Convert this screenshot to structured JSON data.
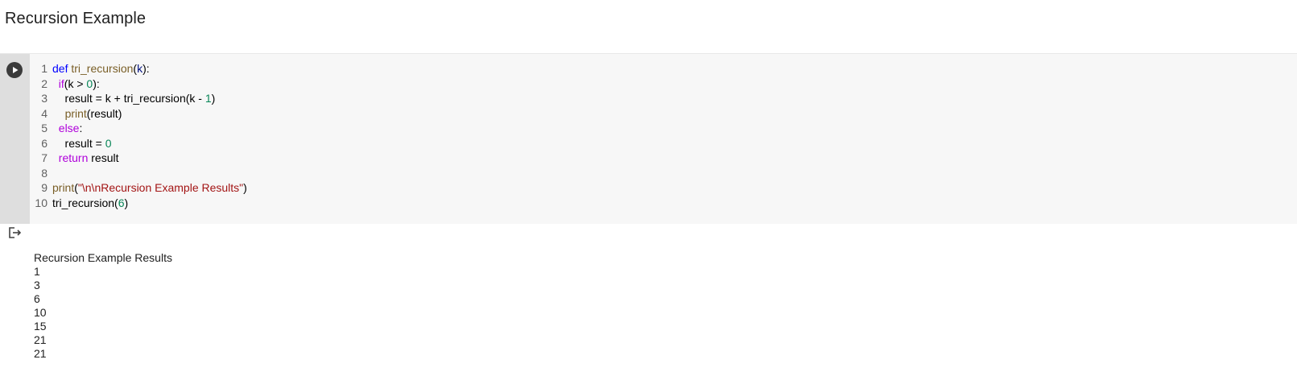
{
  "page": {
    "heading": "Recursion Example"
  },
  "cell": {
    "lines": [
      {
        "num": "1",
        "tokens": [
          {
            "t": "def",
            "c": "k"
          },
          {
            "t": " ",
            "c": "plain"
          },
          {
            "t": "tri_recursion",
            "c": "fn"
          },
          {
            "t": "(",
            "c": "plain"
          },
          {
            "t": "k",
            "c": "id"
          },
          {
            "t": "):",
            "c": "plain"
          }
        ]
      },
      {
        "num": "2",
        "tokens": [
          {
            "t": "  ",
            "c": "plain"
          },
          {
            "t": "if",
            "c": "kw"
          },
          {
            "t": "(k > ",
            "c": "plain"
          },
          {
            "t": "0",
            "c": "num"
          },
          {
            "t": "):",
            "c": "plain"
          }
        ]
      },
      {
        "num": "3",
        "tokens": [
          {
            "t": "    result = k + tri_recursion(k - ",
            "c": "plain"
          },
          {
            "t": "1",
            "c": "num"
          },
          {
            "t": ")",
            "c": "plain"
          }
        ]
      },
      {
        "num": "4",
        "tokens": [
          {
            "t": "    ",
            "c": "plain"
          },
          {
            "t": "print",
            "c": "fn"
          },
          {
            "t": "(result)",
            "c": "plain"
          }
        ]
      },
      {
        "num": "5",
        "tokens": [
          {
            "t": "  ",
            "c": "plain"
          },
          {
            "t": "else",
            "c": "kw"
          },
          {
            "t": ":",
            "c": "plain"
          }
        ]
      },
      {
        "num": "6",
        "tokens": [
          {
            "t": "    result = ",
            "c": "plain"
          },
          {
            "t": "0",
            "c": "num"
          }
        ]
      },
      {
        "num": "7",
        "tokens": [
          {
            "t": "  ",
            "c": "plain"
          },
          {
            "t": "return",
            "c": "kw"
          },
          {
            "t": " result",
            "c": "plain"
          }
        ]
      },
      {
        "num": "8",
        "tokens": []
      },
      {
        "num": "9",
        "tokens": [
          {
            "t": "print",
            "c": "fn"
          },
          {
            "t": "(",
            "c": "plain"
          },
          {
            "t": "\"\\n\\nRecursion Example Results\"",
            "c": "str"
          },
          {
            "t": ")",
            "c": "plain"
          }
        ]
      },
      {
        "num": "10",
        "tokens": [
          {
            "t": "tri_recursion(",
            "c": "plain"
          },
          {
            "t": "6",
            "c": "num"
          },
          {
            "t": ")",
            "c": "plain"
          }
        ]
      }
    ]
  },
  "output": {
    "lines": [
      "Recursion Example Results",
      "1",
      "3",
      "6",
      "10",
      "15",
      "21",
      "21"
    ]
  },
  "icons": {
    "run": "play-circle-icon",
    "output": "output-arrow-icon"
  },
  "colors": {
    "keyword_def": "#0000ff",
    "keyword_flow": "#af00db",
    "function": "#795e26",
    "number": "#098658",
    "string": "#a31515"
  }
}
